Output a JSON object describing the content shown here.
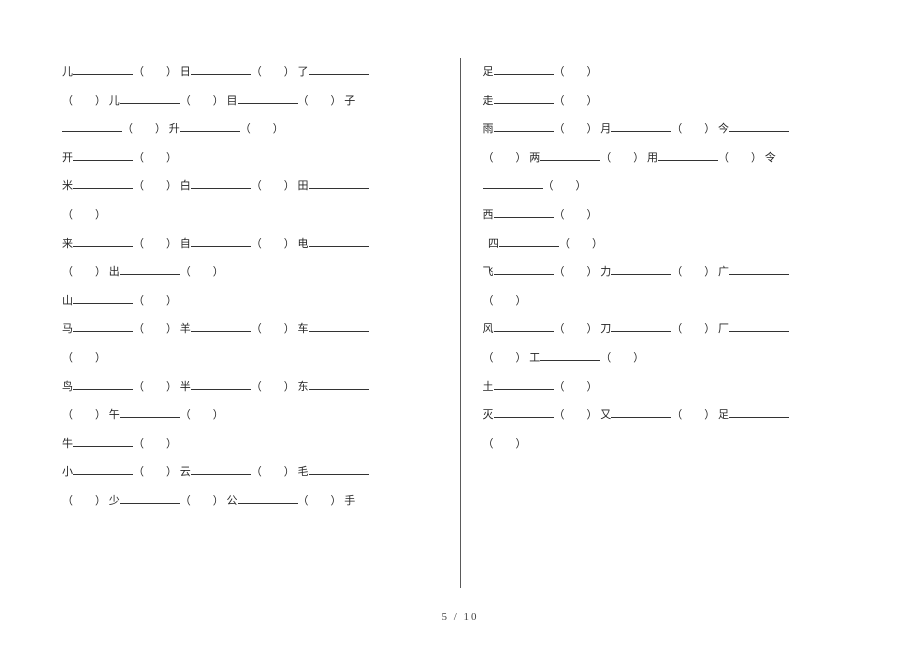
{
  "footer": "5 / 10",
  "left": {
    "lines": [
      "儿{L}（{P}） 日{L}（{P}） 了{L}",
      "（{P}） 儿{L}（{P}） 目{L}（{P}） 子",
      "{L}（{P}） 升{L}（{P}）",
      "开{L}（{P}）",
      "米{L}（{P}） 白{L}（{P}） 田{L}",
      "（{P}）",
      "来{L}（{P}） 自{L}（{P}） 电{L}",
      "（{P}） 出{L}（{P}）",
      "山{L}（{P}）",
      "马{L}（{P}） 羊{L}（{P}） 车{L}",
      "（{P}）",
      "鸟{L}（{P}） 半{L}（{P}） 东{L}",
      "（{P}） 午{L}（{P}）",
      "牛{L}（{P}）",
      "小{L}（{P}） 云{L}（{P}） 毛{L}",
      "（{P}） 少{L}（{P}） 公{L}（{P}） 手"
    ]
  },
  "right": {
    "lines": [
      "足{L}（{P}）",
      "走{L}（{P}）",
      "雨{L}（{P}） 月{L}（{P}） 今{L}",
      "（{P}） 两{L}（{P}） 用{L}（{P}） 令",
      "{L}（{P}）",
      "西{L}（{P}）",
      "  四{L}（{P}）",
      "",
      "飞{L}（{P}） 力{L}（{P}） 广{L}",
      "（{P}）",
      "风{L}（{P}） 刀{L}（{P}） 厂{L}",
      "（{P}） 工{L}（{P}）",
      "土{L}（{P}）",
      "灭{L}（{P}） 又{L}（{P}） 足{L}",
      "（{P}）"
    ]
  }
}
